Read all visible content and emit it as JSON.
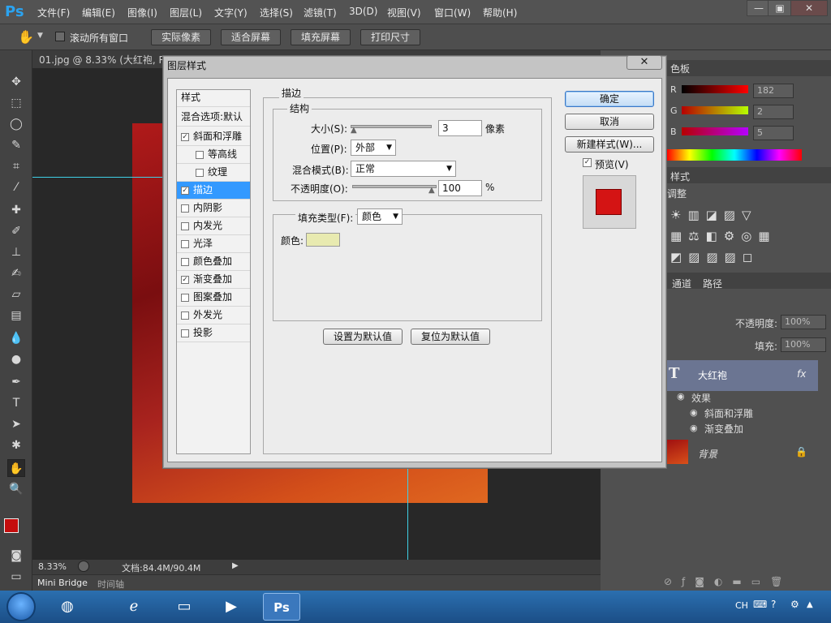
{
  "app": {
    "logo": "Ps"
  },
  "menu": [
    "文件(F)",
    "编辑(E)",
    "图像(I)",
    "图层(L)",
    "文字(Y)",
    "选择(S)",
    "滤镜(T)",
    "3D(D)",
    "视图(V)",
    "窗口(W)",
    "帮助(H)"
  ],
  "window_controls": {
    "minimize": "—",
    "restore": "▣",
    "close": "✕"
  },
  "options_bar": {
    "scroll_all_label": "滚动所有窗口",
    "actual_pixels": "实际像素",
    "fit_screen": "适合屏幕",
    "fill_screen": "填充屏幕",
    "print_size": "打印尺寸"
  },
  "document": {
    "tab_title": "01.jpg @ 8.33% (大红袍, RG",
    "zoom": "8.33%",
    "doc_info": "文档:84.4M/90.4M"
  },
  "bottom_tabs": {
    "mini_bridge": "Mini Bridge",
    "timeline": "时间轴"
  },
  "color_panel": {
    "tab": "色板",
    "channels": [
      {
        "label": "R",
        "value": "182"
      },
      {
        "label": "G",
        "value": "2"
      },
      {
        "label": "B",
        "value": "5"
      }
    ]
  },
  "styles_panel": {
    "tab": "样式",
    "adjust_label": "调整"
  },
  "layers_panel": {
    "tabs": [
      "通道",
      "路径"
    ],
    "opacity_label": "不透明度:",
    "opacity_value": "100%",
    "fill_label": "填充:",
    "fill_value": "100%",
    "text_layer": {
      "name": "大红袍",
      "fx": "fx",
      "icon": "T"
    },
    "effects_label": "效果",
    "effects": [
      "斜面和浮雕",
      "渐变叠加"
    ],
    "background_layer": "背景"
  },
  "taskbar": {
    "lang": "CH"
  },
  "dialog": {
    "title": "图层样式",
    "close": "✕",
    "styles_header": "样式",
    "blend_options": "混合选项:默认",
    "style_items": [
      {
        "label": "斜面和浮雕",
        "checked": true
      },
      {
        "label": "等高线",
        "checked": false
      },
      {
        "label": "纹理",
        "checked": false
      },
      {
        "label": "描边",
        "checked": true
      },
      {
        "label": "内阴影",
        "checked": false
      },
      {
        "label": "内发光",
        "checked": false
      },
      {
        "label": "光泽",
        "checked": false
      },
      {
        "label": "颜色叠加",
        "checked": false
      },
      {
        "label": "渐变叠加",
        "checked": true
      },
      {
        "label": "图案叠加",
        "checked": false
      },
      {
        "label": "外发光",
        "checked": false
      },
      {
        "label": "投影",
        "checked": false
      }
    ],
    "stroke": {
      "section": "描边",
      "structure": "结构",
      "size_label": "大小(S):",
      "size_value": "3",
      "size_unit": "像素",
      "position_label": "位置(P):",
      "position_value": "外部",
      "blend_label": "混合模式(B):",
      "blend_value": "正常",
      "opacity_label": "不透明度(O):",
      "opacity_value": "100",
      "opacity_unit": "%",
      "fill_type_label": "填充类型(F):",
      "fill_type_value": "颜色",
      "color_label": "颜色:",
      "color_swatch": "#e8eab0"
    },
    "make_default": "设置为默认值",
    "reset_default": "复位为默认值",
    "ok": "确定",
    "cancel": "取消",
    "new_style": "新建样式(W)...",
    "preview_label": "预览(V)",
    "preview_swatch": "#d41414"
  }
}
